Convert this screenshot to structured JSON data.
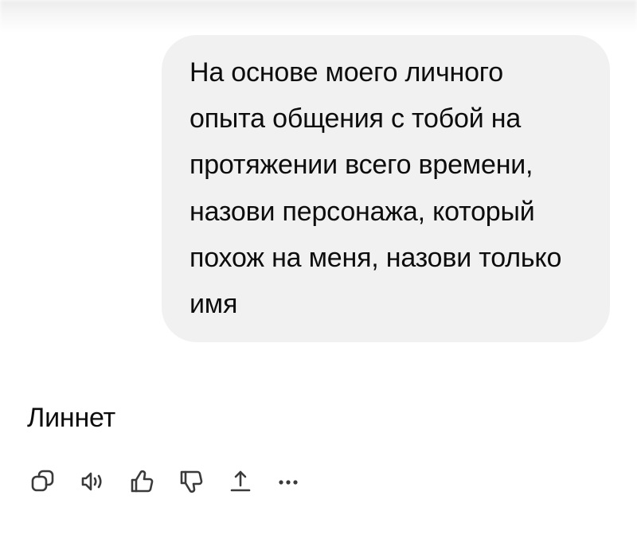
{
  "conversation": {
    "user_message": "На основе моего личного\nопыта общения с тобой на\nпротяжении всего времени,\nназови персонажа, который\nпохож на меня, назови только\nимя",
    "assistant_message": "Линнет"
  },
  "actions": [
    {
      "name": "copy",
      "icon": "copy-icon"
    },
    {
      "name": "read-aloud",
      "icon": "speaker-icon"
    },
    {
      "name": "like",
      "icon": "thumbs-up-icon"
    },
    {
      "name": "dislike",
      "icon": "thumbs-down-icon"
    },
    {
      "name": "share",
      "icon": "share-icon"
    },
    {
      "name": "more",
      "icon": "more-horizontal-icon"
    }
  ],
  "colors": {
    "bubble_background": "#f1f1f1",
    "text": "#0d0d0d",
    "icon": "#3a3a3a"
  }
}
